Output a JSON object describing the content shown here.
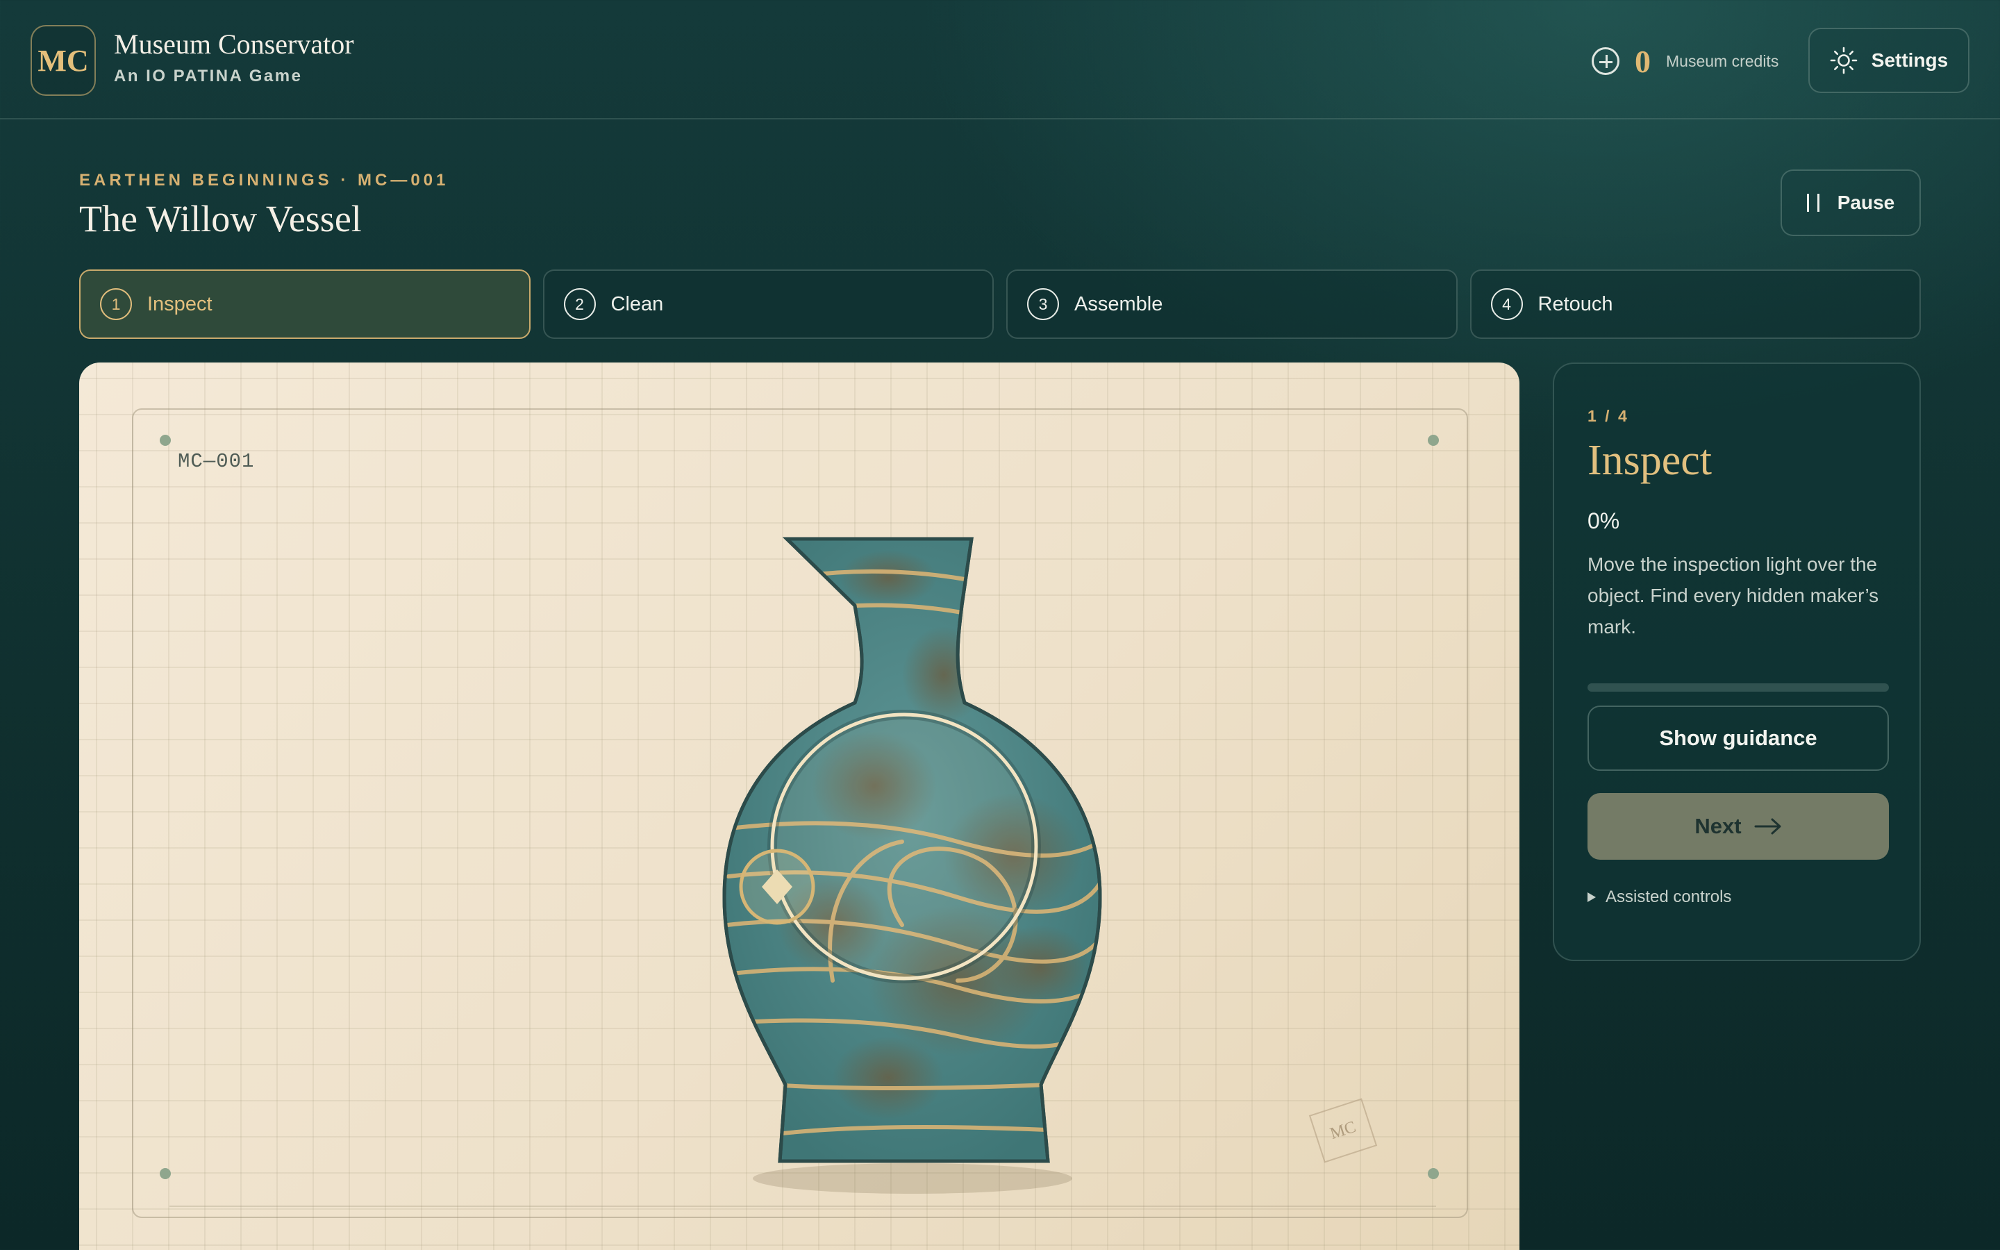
{
  "header": {
    "logo_text": "MC",
    "app_title": "Museum Conservator",
    "app_subtitle": "An IO PATINA Game",
    "credits_value": "0",
    "credits_label": "Museum credits",
    "settings_label": "Settings"
  },
  "level": {
    "eyebrow": "EARTHEN BEGINNINGS · MC—001",
    "title": "The Willow Vessel",
    "pause_label": "Pause"
  },
  "steps": [
    {
      "number": "1",
      "label": "Inspect",
      "active": true
    },
    {
      "number": "2",
      "label": "Clean",
      "active": false
    },
    {
      "number": "3",
      "label": "Assemble",
      "active": false
    },
    {
      "number": "4",
      "label": "Retouch",
      "active": false
    }
  ],
  "workbench": {
    "catalog_id": "MC—001",
    "stamp_text": "MC"
  },
  "panel": {
    "counter": "1 / 4",
    "title": "Inspect",
    "percent_text": "0%",
    "progress": 0,
    "instructions": "Move the inspection light over the object. Find every hidden maker’s mark.",
    "guidance_label": "Show guidance",
    "next_label": "Next",
    "assist_label": "Assisted controls"
  },
  "colors": {
    "accent_gold": "#d7b172",
    "background_teal": "#12353",
    "vessel_teal": "#4f8585",
    "bench_paper": "#f0e4cf",
    "next_button": "#747b66"
  },
  "icons": {
    "credits": "plus-circle-icon",
    "settings": "sun-icon",
    "pause": "pause-icon",
    "next": "arrow-right-icon",
    "assist": "triangle-right-icon",
    "marker": "diamond-icon"
  }
}
